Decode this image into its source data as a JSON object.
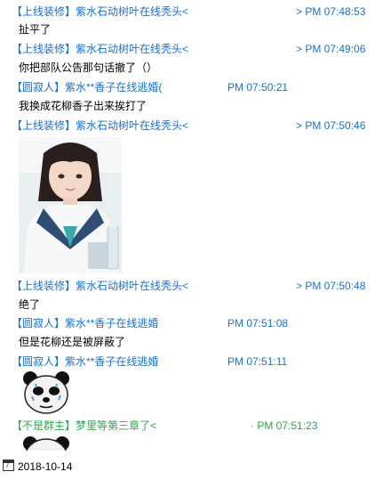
{
  "messages": [
    {
      "sender": "【上线装修】紫水石动树叶在线秃头<",
      "time": "> PM 07:48:53",
      "text": "扯平了"
    },
    {
      "sender": "【上线装修】紫水石动树叶在线秃头<",
      "time": "> PM 07:49:06",
      "text": "你把部队公告那句话撤了（）"
    },
    {
      "sender": "【圆寂人】紫水**香子在线逃婚(",
      "time": "PM 07:50:21",
      "text": "我换成花柳香子出来挨打了"
    },
    {
      "sender": "【上线装修】紫水石动树叶在线秃头<",
      "time": "> PM 07:50:46",
      "text": ""
    },
    {
      "sender": "【上线装修】紫水石动树叶在线秃头<",
      "time": "> PM 07:50:48",
      "text": "绝了"
    },
    {
      "sender": "【圆寂人】紫水**香子在线逃婚",
      "time": "PM 07:51:08",
      "text": "但是花柳还是被屏蔽了"
    },
    {
      "sender": "【圆寂人】紫水**香子在线逃婚",
      "time": "PM 07:51:11",
      "text": ""
    },
    {
      "sender": "【不是群主】梦里等第三章了<",
      "time": "· PM 07:51:23",
      "text": ""
    }
  ],
  "footer": {
    "date": "2018-10-14",
    "icon": "calendar-icon"
  },
  "colors": {
    "sender_blue": "#1a6fc8",
    "sender_green": "#2aa84a"
  }
}
